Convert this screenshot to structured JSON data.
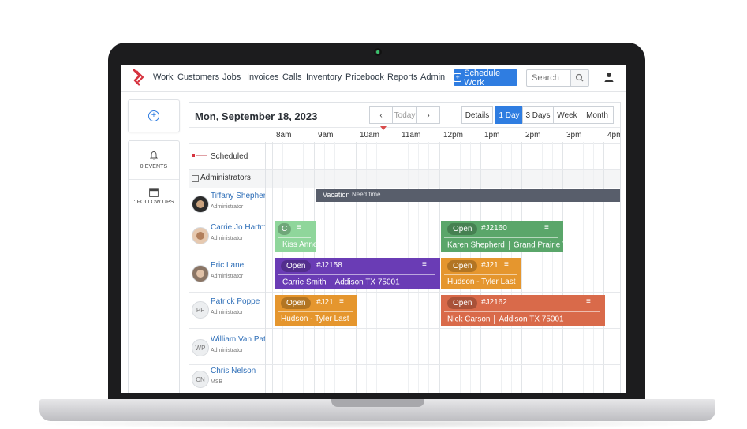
{
  "nav": {
    "items": [
      "Work",
      "Customers",
      "Jobs",
      "Invoices",
      "Calls",
      "Inventory",
      "Pricebook",
      "Reports",
      "Admin"
    ],
    "schedule_button": "Schedule Work",
    "search_placeholder": "Search"
  },
  "sidebar": {
    "events_label": "0 EVENTS",
    "followups_label": ": FOLLOW UPS"
  },
  "calendar": {
    "date_title": "Mon, September 18, 2023",
    "today_label": "Today",
    "views": [
      "Details",
      "1 Day",
      "3 Days",
      "Week",
      "Month"
    ],
    "active_view": "1 Day",
    "hours": [
      "8am",
      "9am",
      "10am",
      "11am",
      "12pm",
      "1pm",
      "2pm",
      "3pm",
      "4pm"
    ],
    "scheduled_label": "Scheduled",
    "group_label": "Administrators"
  },
  "resources": [
    {
      "name": "Tiffany Shepherd",
      "role": "Administrator",
      "initials": ""
    },
    {
      "name": "Carrie Jo Hartman",
      "role": "Administrator",
      "initials": ""
    },
    {
      "name": "Eric Lane",
      "role": "Administrator",
      "initials": ""
    },
    {
      "name": "Patrick Poppe",
      "role": "Administrator",
      "initials": "PF"
    },
    {
      "name": "William Van Patten",
      "role": "Administrator",
      "initials": "WP"
    },
    {
      "name": "Chris Nelson",
      "role": "MSB",
      "initials": "CN"
    }
  ],
  "events": {
    "vacation": {
      "label": "Vacation",
      "note": "Need time",
      "color": "#585e6b"
    },
    "e1": {
      "status": "C",
      "customer": "Kiss Anne",
      "color": "#8fd69b"
    },
    "e2": {
      "status": "Open",
      "job": "#J2160",
      "customer": "Karen Shepherd",
      "location": "Grand Prairie TX",
      "color": "#5aa66a"
    },
    "e3": {
      "status": "Open",
      "job": "#J2158",
      "customer": "Carrie Smith",
      "location": "Addison TX 75001",
      "color": "#6a3cb5"
    },
    "e4": {
      "status": "Open",
      "job": "#J21",
      "customer": "Hudson - Tyler Last",
      "color": "#e5962e"
    },
    "e5": {
      "status": "Open",
      "job": "#J21",
      "customer": "Hudson - Tyler Last",
      "color": "#e5962e"
    },
    "e6": {
      "status": "Open",
      "job": "#J2162",
      "customer": "Nick Carson",
      "location": "Addison TX 75001",
      "color": "#d96a4a"
    }
  },
  "colors": {
    "accent": "#2f7de1",
    "now_line": "#d94b4b"
  }
}
